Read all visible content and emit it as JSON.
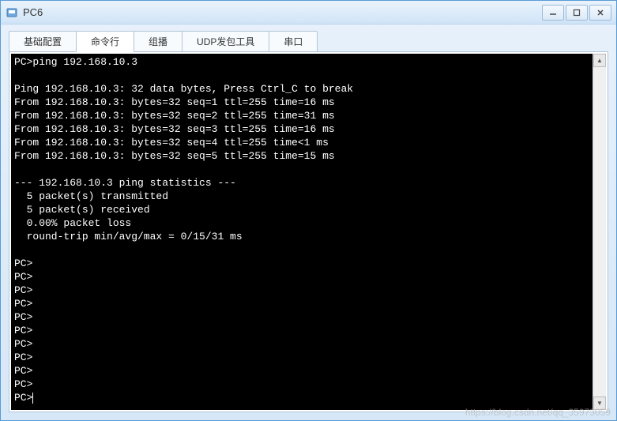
{
  "window": {
    "title": "PC6"
  },
  "tabs": [
    {
      "label": "基础配置"
    },
    {
      "label": "命令行"
    },
    {
      "label": "组播"
    },
    {
      "label": "UDP发包工具"
    },
    {
      "label": "串口"
    }
  ],
  "terminal": {
    "lines": [
      "PC>ping 192.168.10.3",
      "",
      "Ping 192.168.10.3: 32 data bytes, Press Ctrl_C to break",
      "From 192.168.10.3: bytes=32 seq=1 ttl=255 time=16 ms",
      "From 192.168.10.3: bytes=32 seq=2 ttl=255 time=31 ms",
      "From 192.168.10.3: bytes=32 seq=3 ttl=255 time=16 ms",
      "From 192.168.10.3: bytes=32 seq=4 ttl=255 time<1 ms",
      "From 192.168.10.3: bytes=32 seq=5 ttl=255 time=15 ms",
      "",
      "--- 192.168.10.3 ping statistics ---",
      "  5 packet(s) transmitted",
      "  5 packet(s) received",
      "  0.00% packet loss",
      "  round-trip min/avg/max = 0/15/31 ms",
      "",
      "PC>",
      "PC>",
      "PC>",
      "PC>",
      "PC>",
      "PC>",
      "PC>",
      "PC>",
      "PC>",
      "PC>",
      "PC>"
    ]
  },
  "watermark": "https://blog.csdn.net/qq_35973059"
}
